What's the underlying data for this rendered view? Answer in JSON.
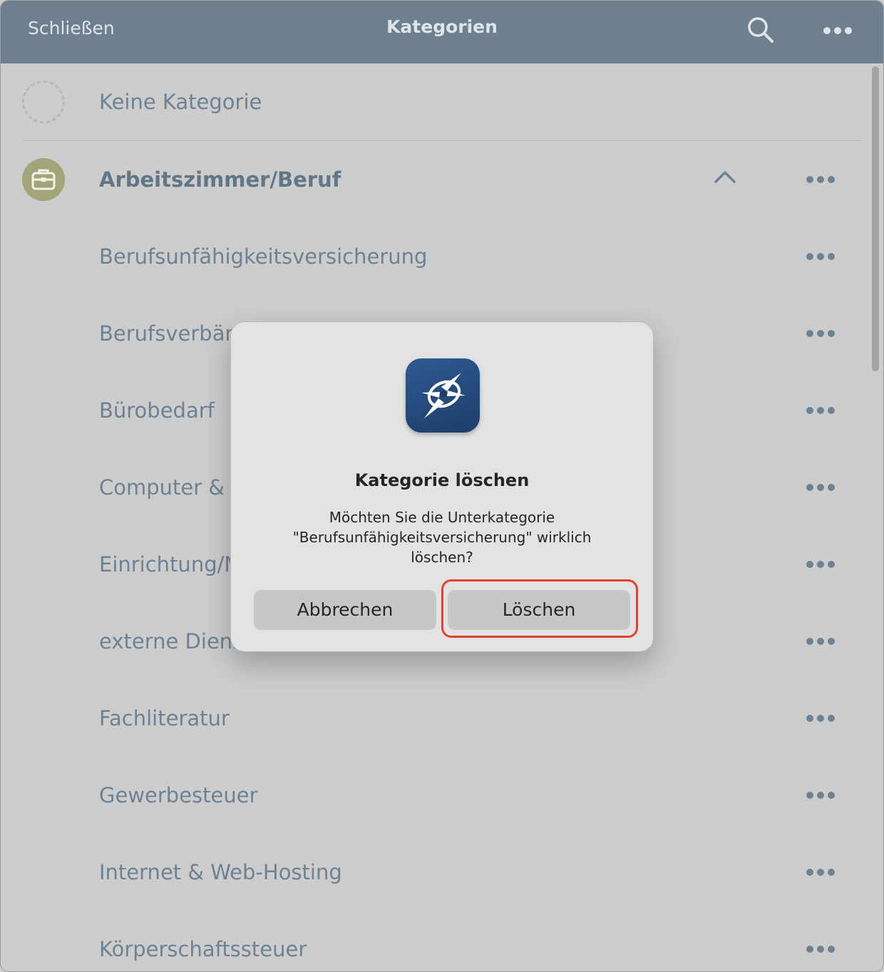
{
  "header": {
    "close_label": "Schließen",
    "title": "Kategorien",
    "search_icon": "search-icon",
    "more_icon": "more-icon"
  },
  "list": {
    "none_label": "Keine Kategorie",
    "category": {
      "label": "Arbeitszimmer/Beruf",
      "icon": "briefcase-icon",
      "icon_color": "#a2a479",
      "expanded": true
    },
    "subcategories": [
      "Berufsunfähigkeitsversicherung",
      "Berufsverbän",
      "Bürobedarf",
      "Computer & S",
      "Einrichtung/M",
      "externe Diens",
      "Fachliteratur",
      "Gewerbesteuer",
      "Internet & Web-Hosting",
      "Körperschaftssteuer"
    ]
  },
  "dialog": {
    "title": "Kategorie löschen",
    "message": "Möchten Sie die Unterkategorie \"Berufsunfähigkeitsversicherung\" wirklich löschen?",
    "cancel_label": "Abbrechen",
    "delete_label": "Löschen",
    "highlight_color": "#e0442c"
  },
  "colors": {
    "header_bg": "#6e7f8f",
    "list_bg": "#cdcdcd",
    "text": "#6f8293",
    "app_icon": "#1c3d69"
  }
}
